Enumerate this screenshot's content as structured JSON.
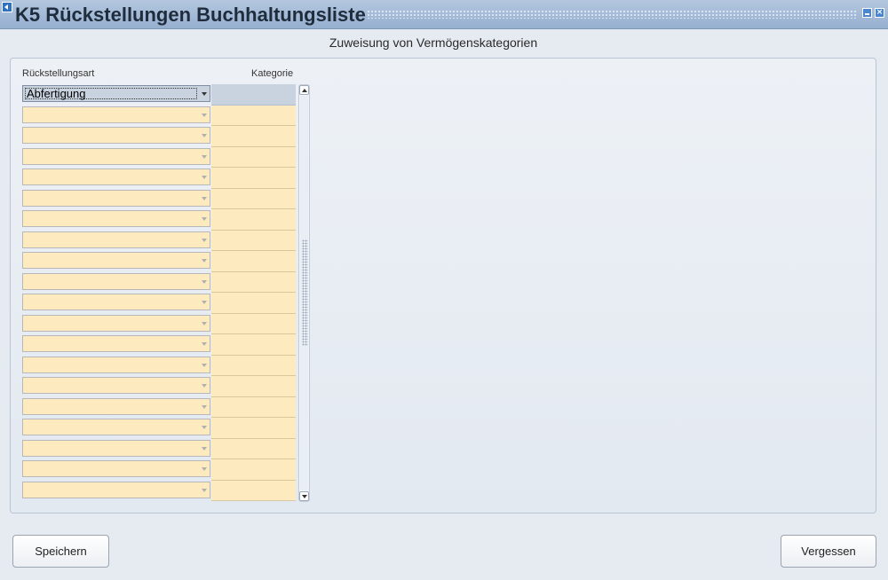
{
  "window": {
    "title": "K5 Rückstellungen Buchhaltungsliste",
    "icon": "app-window-icon",
    "minimize_icon": "minimize-icon",
    "close_icon": "close-icon",
    "colors": {
      "titlebar": "#a6bcd8",
      "accent": "#4a87d0"
    }
  },
  "form": {
    "subtitle": "Zuweisung von Vermögenskategorien",
    "columns": {
      "art": "Rückstellungsart",
      "kategorie": "Kategorie"
    },
    "rows": [
      {
        "art": "Abfertigung",
        "kategorie": ""
      },
      {
        "art": "",
        "kategorie": ""
      },
      {
        "art": "",
        "kategorie": ""
      },
      {
        "art": "",
        "kategorie": ""
      },
      {
        "art": "",
        "kategorie": ""
      },
      {
        "art": "",
        "kategorie": ""
      },
      {
        "art": "",
        "kategorie": ""
      },
      {
        "art": "",
        "kategorie": ""
      },
      {
        "art": "",
        "kategorie": ""
      },
      {
        "art": "",
        "kategorie": ""
      },
      {
        "art": "",
        "kategorie": ""
      },
      {
        "art": "",
        "kategorie": ""
      },
      {
        "art": "",
        "kategorie": ""
      },
      {
        "art": "",
        "kategorie": ""
      },
      {
        "art": "",
        "kategorie": ""
      },
      {
        "art": "",
        "kategorie": ""
      },
      {
        "art": "",
        "kategorie": ""
      },
      {
        "art": "",
        "kategorie": ""
      },
      {
        "art": "",
        "kategorie": ""
      },
      {
        "art": "",
        "kategorie": ""
      }
    ],
    "field_color": "#fdeabf",
    "selected_color": "#c9d3e0"
  },
  "buttons": {
    "save": "Speichern",
    "forget": "Vergessen"
  }
}
